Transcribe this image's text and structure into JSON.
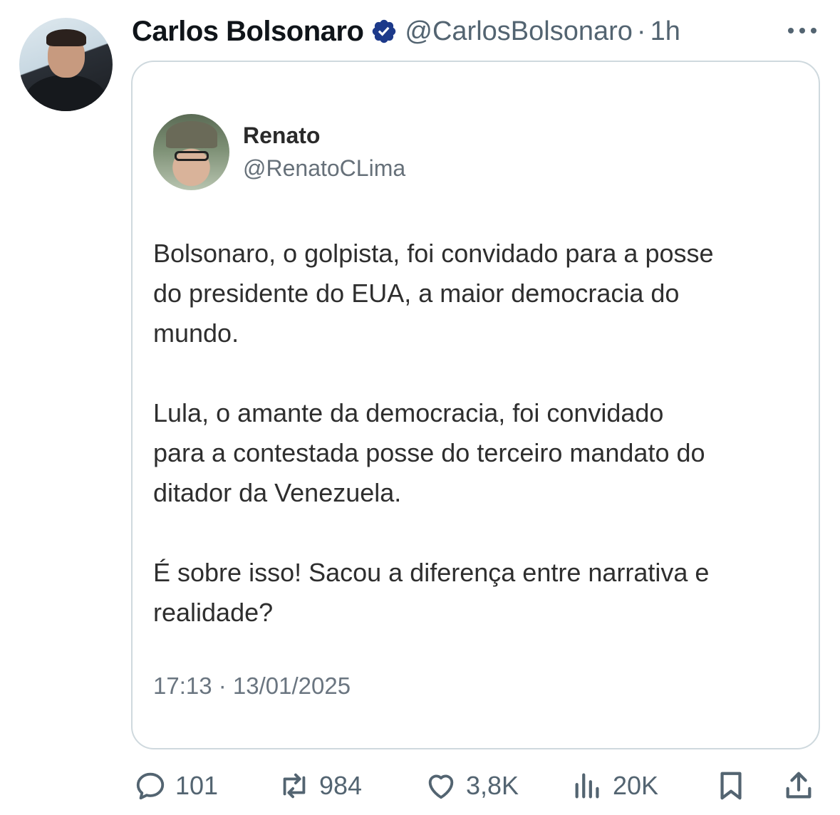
{
  "post": {
    "author_name": "Carlos Bolsonaro",
    "author_handle": "@CarlosBolsonaro",
    "separator": "·",
    "time_ago": "1h",
    "verified_color": "#1d3a8a"
  },
  "quoted": {
    "name": "Renato",
    "handle": "@RenatoCLima",
    "text": "Bolsonaro, o golpista, foi convidado para a posse\ndo presidente do EUA, a maior democracia do\nmundo.\n\nLula, o amante da democracia, foi convidado\npara a contestada posse do terceiro mandato do\nditador da Venezuela.\n\nÉ sobre isso!  Sacou a diferença entre narrativa e\nrealidade?",
    "timestamp": "17:13 · 13/01/2025"
  },
  "actions": {
    "replies": "101",
    "reposts": "984",
    "likes": "3,8K",
    "views": "20K"
  },
  "icons": [
    "verified-badge-icon",
    "more-icon",
    "reply-icon",
    "repost-icon",
    "like-icon",
    "views-icon",
    "bookmark-icon",
    "share-icon"
  ]
}
